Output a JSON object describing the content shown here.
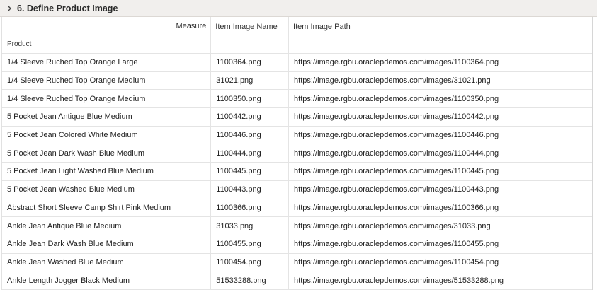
{
  "section": {
    "title": "6. Define Product Image",
    "icon": "chevron-right-icon"
  },
  "table": {
    "measure_label": "Measure",
    "row_dimension_label": "Product",
    "columns": [
      "Item Image Name",
      "Item Image Path"
    ],
    "rows": [
      {
        "product": "1/4 Sleeve Ruched Top Orange Large",
        "image_name": "1100364.png",
        "image_path": "https://image.rgbu.oraclepdemos.com/images/1100364.png"
      },
      {
        "product": "1/4 Sleeve Ruched Top Orange Medium",
        "image_name": "31021.png",
        "image_path": "https://image.rgbu.oraclepdemos.com/images/31021.png"
      },
      {
        "product": "1/4 Sleeve Ruched Top Orange Medium",
        "image_name": "1100350.png",
        "image_path": "https://image.rgbu.oraclepdemos.com/images/1100350.png"
      },
      {
        "product": "5 Pocket Jean Antique Blue Medium",
        "image_name": "1100442.png",
        "image_path": "https://image.rgbu.oraclepdemos.com/images/1100442.png"
      },
      {
        "product": "5 Pocket Jean Colored White Medium",
        "image_name": "1100446.png",
        "image_path": "https://image.rgbu.oraclepdemos.com/images/1100446.png"
      },
      {
        "product": "5 Pocket Jean Dark Wash Blue Medium",
        "image_name": "1100444.png",
        "image_path": "https://image.rgbu.oraclepdemos.com/images/1100444.png"
      },
      {
        "product": "5 Pocket Jean Light Washed Blue Medium",
        "image_name": "1100445.png",
        "image_path": "https://image.rgbu.oraclepdemos.com/images/1100445.png"
      },
      {
        "product": "5 Pocket Jean Washed Blue Medium",
        "image_name": "1100443.png",
        "image_path": "https://image.rgbu.oraclepdemos.com/images/1100443.png"
      },
      {
        "product": "Abstract Short Sleeve Camp Shirt Pink Medium",
        "image_name": "1100366.png",
        "image_path": "https://image.rgbu.oraclepdemos.com/images/1100366.png"
      },
      {
        "product": "Ankle Jean Antique Blue Medium",
        "image_name": "31033.png",
        "image_path": "https://image.rgbu.oraclepdemos.com/images/31033.png"
      },
      {
        "product": "Ankle Jean Dark Wash Blue Medium",
        "image_name": "1100455.png",
        "image_path": "https://image.rgbu.oraclepdemos.com/images/1100455.png"
      },
      {
        "product": "Ankle Jean Washed Blue Medium",
        "image_name": "1100454.png",
        "image_path": "https://image.rgbu.oraclepdemos.com/images/1100454.png"
      },
      {
        "product": "Ankle Length Jogger Black Medium",
        "image_name": "51533288.png",
        "image_path": "https://image.rgbu.oraclepdemos.com/images/51533288.png"
      }
    ]
  }
}
